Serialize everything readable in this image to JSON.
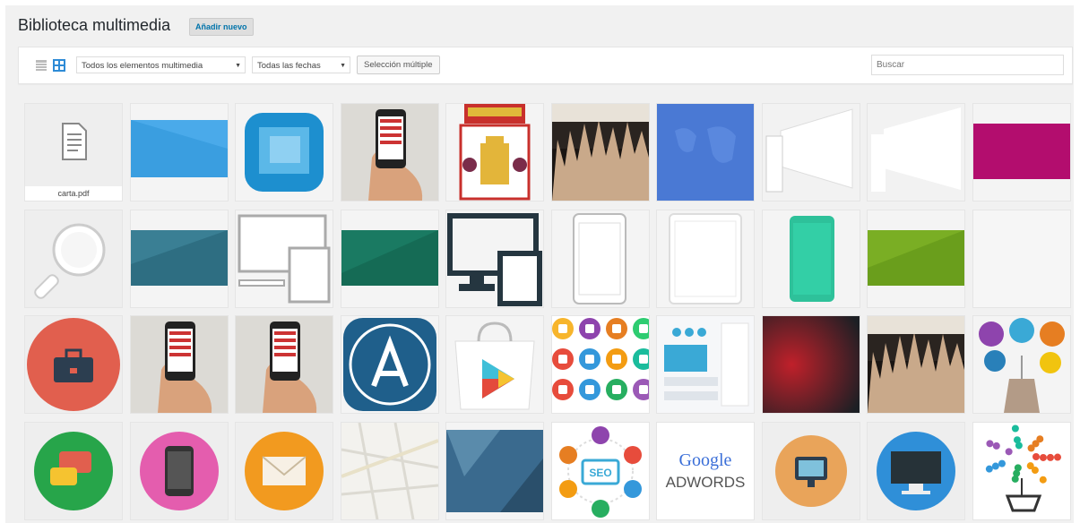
{
  "header": {
    "title": "Biblioteca multimedia",
    "add_new": "Añadir nuevo"
  },
  "toolbar": {
    "view_list_icon": "list-view-icon",
    "view_grid_icon": "grid-view-icon",
    "filter_type": "Todos los elementos multimedia",
    "filter_date": "Todas las fechas",
    "bulk_select": "Selección múltiple",
    "search_placeholder": "Buscar"
  },
  "colors": {
    "accent": "#0073aa",
    "background": "#f1f1f1"
  },
  "media": [
    {
      "kind": "pdf",
      "filename": "carta.pdf"
    },
    {
      "kind": "blue-banner"
    },
    {
      "kind": "app-icon-blue"
    },
    {
      "kind": "hand-phone"
    },
    {
      "kind": "coat-of-arms"
    },
    {
      "kind": "crowd-photo"
    },
    {
      "kind": "world-map-blue"
    },
    {
      "kind": "white-screen-shapes"
    },
    {
      "kind": "white-screen-shapes-2"
    },
    {
      "kind": "magenta-banner"
    },
    {
      "kind": "magnifier-icon"
    },
    {
      "kind": "teal-banner"
    },
    {
      "kind": "devices-outline"
    },
    {
      "kind": "green-banner"
    },
    {
      "kind": "devices-dark"
    },
    {
      "kind": "tablet-white"
    },
    {
      "kind": "tablet-white-2"
    },
    {
      "kind": "phone-teal"
    },
    {
      "kind": "lime-banner"
    },
    {
      "kind": "blank"
    },
    {
      "kind": "briefcase-icon"
    },
    {
      "kind": "hand-phone"
    },
    {
      "kind": "hand-phone"
    },
    {
      "kind": "app-store-icon"
    },
    {
      "kind": "play-store-icon"
    },
    {
      "kind": "app-icons-grid"
    },
    {
      "kind": "ui-kit"
    },
    {
      "kind": "red-dark-gradient"
    },
    {
      "kind": "crowd-photo"
    },
    {
      "kind": "social-tag"
    },
    {
      "kind": "chat-icon"
    },
    {
      "kind": "mobile-icon"
    },
    {
      "kind": "mail-icon"
    },
    {
      "kind": "street-map"
    },
    {
      "kind": "blue-polygon"
    },
    {
      "kind": "seo-diagram",
      "text": "SEO"
    },
    {
      "kind": "google-adwords",
      "text1": "Google",
      "text2": "ADWORDS"
    },
    {
      "kind": "monitor-orange"
    },
    {
      "kind": "monitor-blue"
    },
    {
      "kind": "tree-cart"
    }
  ]
}
